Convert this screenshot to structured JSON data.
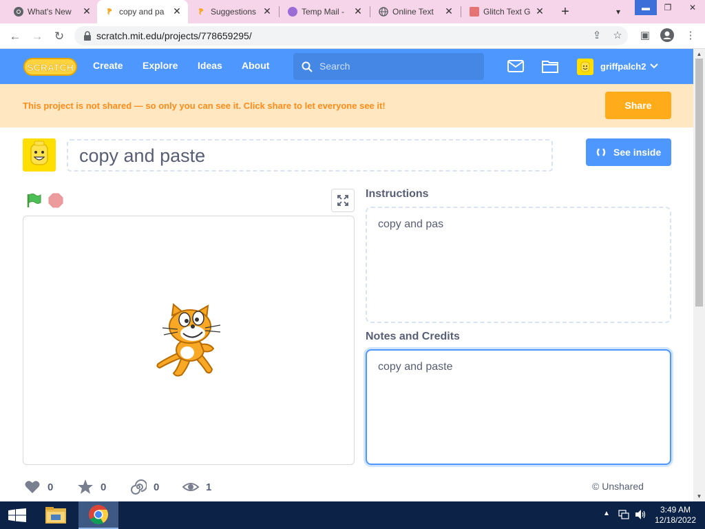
{
  "browser": {
    "tabs": [
      {
        "label": "What's New",
        "icon": "chrome-icon"
      },
      {
        "label": "copy and pa",
        "icon": "scratch-icon",
        "active": true
      },
      {
        "label": "Suggestions",
        "icon": "scratch-icon"
      },
      {
        "label": "Temp Mail -",
        "icon": "tempmail-icon"
      },
      {
        "label": "Online Text",
        "icon": "globe-icon"
      },
      {
        "label": "Glitch Text G",
        "icon": "glitch-icon"
      }
    ],
    "new_tab": "+",
    "url": "scratch.mit.edu/projects/778659295/"
  },
  "scratch": {
    "logo": "SCRATCH",
    "nav": {
      "create": "Create",
      "explore": "Explore",
      "ideas": "Ideas",
      "about": "About"
    },
    "search_placeholder": "Search",
    "username": "griffpalch2",
    "banner": {
      "text": "This project is not shared — so only you can see it. Click share to let everyone see it!",
      "share_label": "Share"
    },
    "project": {
      "title": "copy and paste",
      "see_inside_label": "See inside",
      "instructions_heading": "Instructions",
      "instructions_text": "copy and pas",
      "notes_heading": "Notes and Credits",
      "notes_text": "copy and paste"
    },
    "stats": {
      "loves": "0",
      "favorites": "0",
      "remixes": "0",
      "views": "1"
    },
    "share_status": "Unshared",
    "share_status_icon": "©"
  },
  "taskbar": {
    "time": "3:49 AM",
    "date": "12/18/2022"
  },
  "colors": {
    "scratch_blue": "#4d97ff",
    "banner_bg": "#ffe7c2",
    "banner_text": "#ff8c1a",
    "share_orange": "#ffab1a",
    "tabbar_pink": "#f6d5ea"
  }
}
